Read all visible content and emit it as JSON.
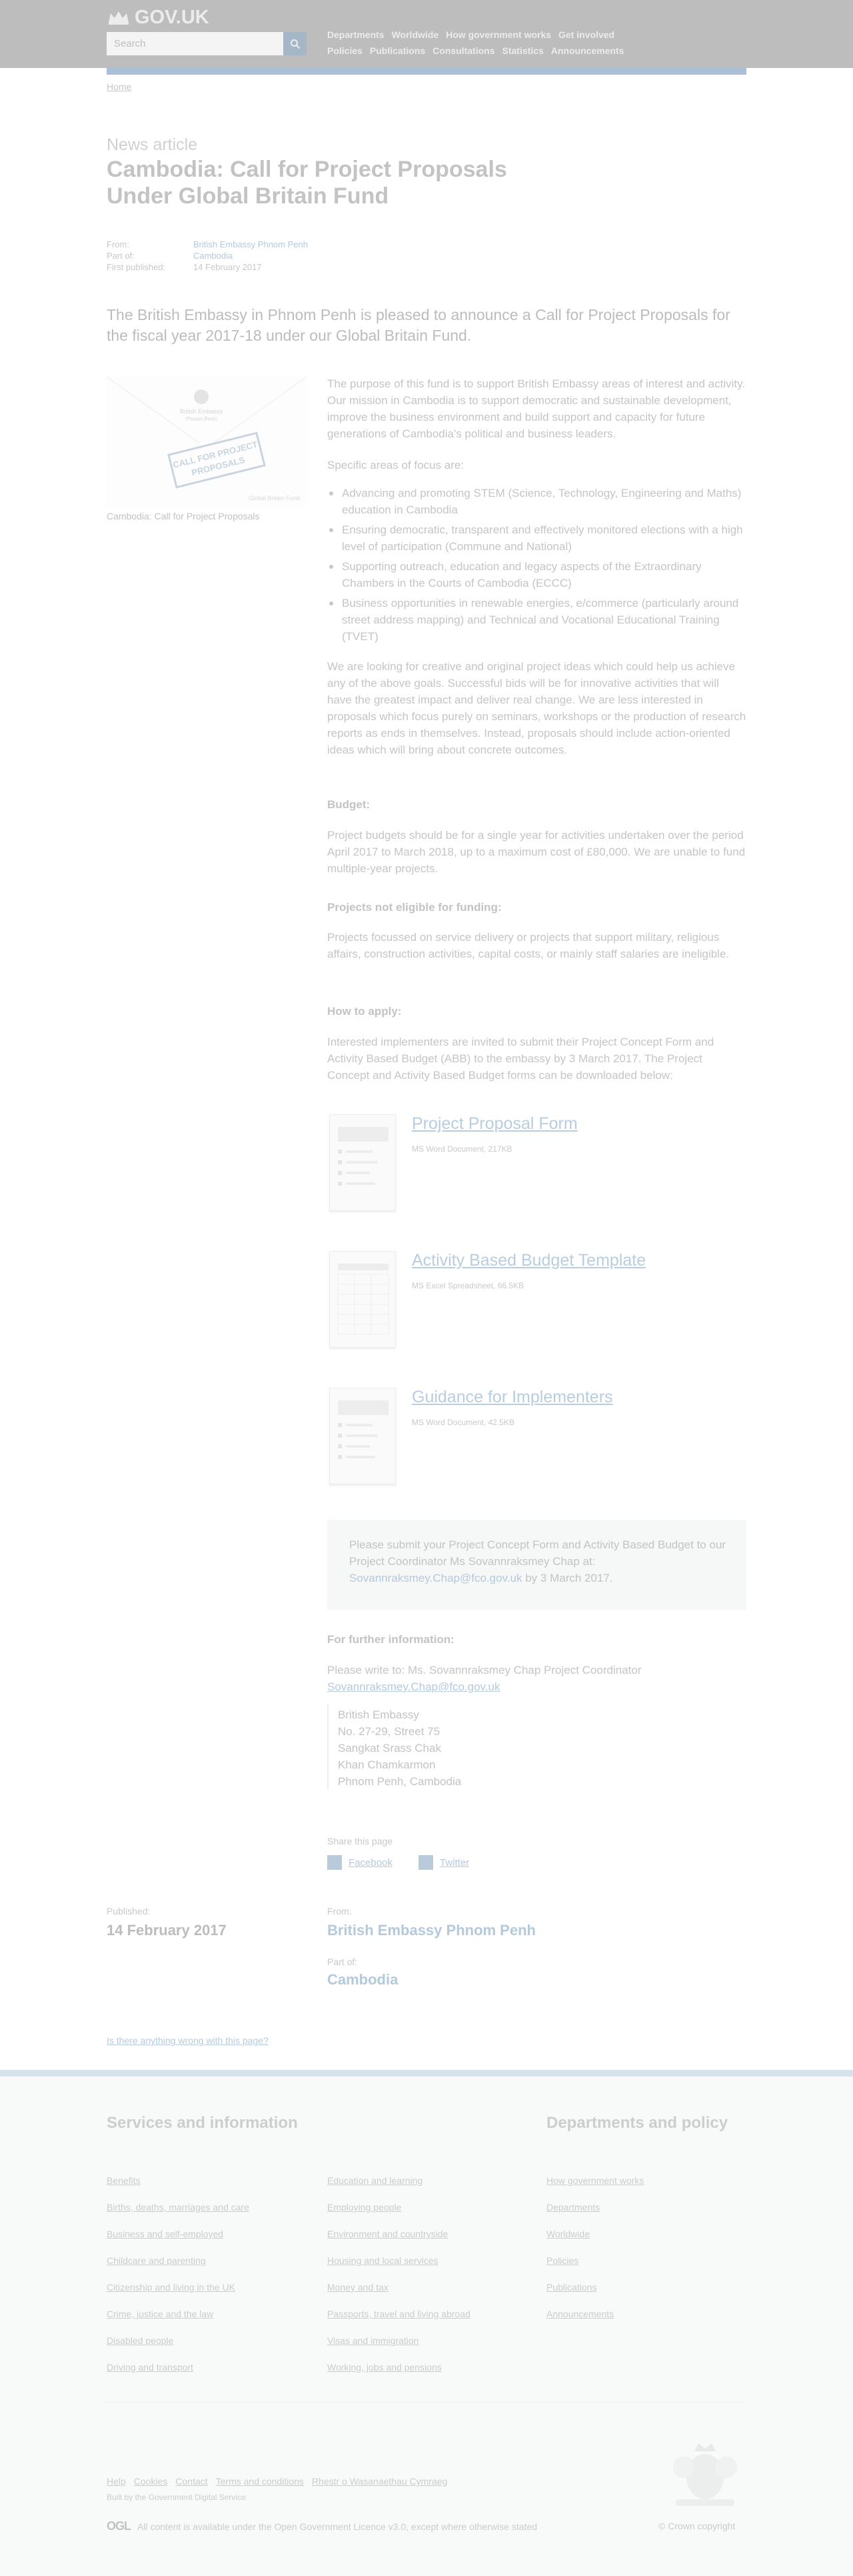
{
  "header": {
    "logo_text": "GOV.UK",
    "search_placeholder": "Search",
    "nav_row1": [
      "Departments",
      "Worldwide",
      "How government works",
      "Get involved"
    ],
    "nav_row2": [
      "Policies",
      "Publications",
      "Consultations",
      "Statistics",
      "Announcements"
    ]
  },
  "breadcrumb": "Home",
  "article": {
    "kind": "News article",
    "title": "Cambodia: Call for Project Proposals Under Global Britain Fund",
    "meta": [
      {
        "label": "From:",
        "value": "British Embassy Phnom Penh"
      },
      {
        "label": "Part of:",
        "value": "Cambodia"
      },
      {
        "label": "First published:",
        "value": "14 February 2017"
      }
    ],
    "lead": "The British Embassy in Phnom Penh is pleased to announce a Call for Project Proposals for the fiscal year 2017-18 under our Global Britain Fund.",
    "image": {
      "embassy_line1": "British Embassy",
      "embassy_line2": "Phnom Penh",
      "stamp_line1": "CALL FOR PROJECT",
      "stamp_line2": "PROPOSALS",
      "fund_text": "Global Britain Fund",
      "caption": "Cambodia: Call for Project Proposals"
    },
    "purpose": "The purpose of this fund is to support British Embassy areas of interest and activity. Our mission in Cambodia is to support democratic and sustainable development, improve the business environment and build support and capacity for future generations of Cambodia's political and business leaders.",
    "focus_intro": "Specific areas of focus are:",
    "focus_items": [
      "Advancing and promoting STEM (Science, Technology, Engineering and Maths) education in Cambodia",
      "Ensuring democratic, transparent and effectively monitored elections with a high level of participation (Commune and National)",
      "Supporting outreach, education and legacy aspects of the Extraordinary Chambers in the Courts of Cambodia (ECCC)",
      "Business opportunities in renewable energies, e/commerce (particularly around street address mapping) and Technical and Vocational Educational Training (TVET)"
    ],
    "looking": "We are looking for creative and original project ideas which could help us achieve any of the above goals. Successful bids will be for innovative activities that will have the greatest impact and deliver real change. We are less interested in proposals which focus purely on seminars, workshops or the production of research reports as ends in themselves. Instead, proposals should include action-oriented ideas which will bring about concrete outcomes.",
    "budget_heading": "Budget:",
    "budget_text": "Project budgets should be for a single year for activities undertaken over the period April 2017 to March 2018, up to a maximum cost of £80,000. We are unable to fund multiple-year projects.",
    "not_eligible_heading": "Projects not eligible for funding:",
    "not_eligible_text": "Projects focussed on service delivery or projects that support military, religious affairs, construction activities, capital costs, or mainly staff salaries are ineligible.",
    "apply_heading": "How to apply:",
    "apply_text": "Interested implementers are invited to submit their Project Concept Form and Activity Based Budget (ABB) to the embassy by 3 March 2017. The Project Concept and Activity Based Budget forms can be downloaded below:",
    "attachments": [
      {
        "title": "Project Proposal Form",
        "meta": "MS Word Document, 217KB"
      },
      {
        "title": "Activity Based Budget Template",
        "meta": "MS Excel Spreadsheet, 66.5KB"
      },
      {
        "title": "Guidance for Implementers",
        "meta": "MS Word Document, 42.5KB"
      }
    ],
    "callout": {
      "text1": "Please submit your Project Concept Form and Activity Based Budget to our Project Coordinator Ms Sovannraksmey Chap",
      "at": "at:",
      "email": "Sovannraksmey.Chap@fco.gov.uk",
      "by": "by 3 March 2017."
    },
    "further_heading": "For further information:",
    "further_text": "Please write to: Ms. Sovannraksmey Chap Project Coordinator",
    "further_email": "Sovannraksmey.Chap@fco.gov.uk",
    "address": [
      "British Embassy",
      "No. 27-29, Street 75",
      "Sangkat Srass Chak",
      "Khan Chamkarmon",
      "Phnom Penh, Cambodia"
    ]
  },
  "share": {
    "label": "Share this page",
    "facebook": "Facebook",
    "twitter": "Twitter"
  },
  "published_block": {
    "published_label": "Published:",
    "published_date": "14 February 2017",
    "from_label": "From:",
    "from_value": "British Embassy Phnom Penh",
    "part_label": "Part of:",
    "part_value": "Cambodia"
  },
  "report_link": "Is there anything wrong with this page?",
  "footer": {
    "services_heading": "Services and information",
    "services_col1": [
      "Benefits",
      "Births, deaths, marriages and care",
      "Business and self-employed",
      "Childcare and parenting",
      "Citizenship and living in the UK",
      "Crime, justice and the law",
      "Disabled people",
      "Driving and transport"
    ],
    "services_col2": [
      "Education and learning",
      "Employing people",
      "Environment and countryside",
      "Housing and local services",
      "Money and tax",
      "Passports, travel and living abroad",
      "Visas and immigration",
      "Working, jobs and pensions"
    ],
    "departments_heading": "Departments and policy",
    "departments_col": [
      "How government works",
      "Departments",
      "Worldwide",
      "Policies",
      "Publications",
      "Announcements"
    ],
    "bottom_links": [
      "Help",
      "Cookies",
      "Contact",
      "Terms and conditions",
      "Rhestr o Wasanaethau Cymraeg"
    ],
    "built_by": "Built by the Government Digital Service",
    "ogl": "OGL",
    "licence_text": "All content is available under the Open Government Licence v3.0, except where otherwise stated",
    "copyright": "© Crown copyright"
  },
  "colors": {
    "header_bg": "#bdbdbd",
    "accent_bar": "#a9c0d6",
    "link": "#b5c9dc",
    "footer_bg": "#f8f9f9"
  }
}
